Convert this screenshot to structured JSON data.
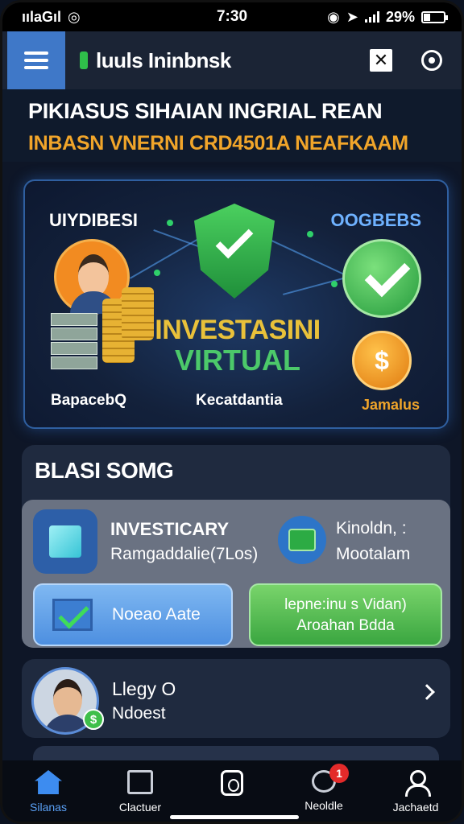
{
  "status_bar": {
    "carrier": "ıılaGıl",
    "time": "7:30",
    "battery": "29%"
  },
  "app_bar": {
    "title": "luuls Ininbnsk"
  },
  "headline": {
    "line1": "PIKIASUS SIHAIAN INGRIAL REAN",
    "line2": "INBASN VNERNI CRD4501A NEAFKAAM"
  },
  "hero": {
    "top_left_label": "UIYDIBESI",
    "top_right_label": "OOGBEBS",
    "brand_line1": "INVESTASINI",
    "brand_line2": "VIRTUAL",
    "coin_symbol": "$",
    "bottom_left_label": "BapacebQ",
    "bottom_center_label": "Kecatdantia",
    "bottom_right_label": "Jamalus"
  },
  "section": {
    "title": "BLASI SOMG",
    "item1_title": "INVESTICARY",
    "item1_subtitle": "Ramgaddalie(7Los)",
    "item2_title": "Kinoldn, :",
    "item2_subtitle": "Mootalam",
    "button_primary": "Noeao Aate",
    "button_secondary_line1": "lepne:inu s Vidan)",
    "button_secondary_line2": "Aroahan Bdda"
  },
  "profile": {
    "name": "Llegy O",
    "subtitle": "Ndoest",
    "badge": "$"
  },
  "bottom_nav": {
    "items": [
      {
        "label": "Silanas",
        "icon": "home-icon"
      },
      {
        "label": "Clactuer",
        "icon": "calendar-icon"
      },
      {
        "label": "",
        "icon": "wallet-icon"
      },
      {
        "label": "Neoldle",
        "icon": "chat-icon"
      },
      {
        "label": "Jachaetd",
        "icon": "user-icon"
      }
    ],
    "notification_count": "1"
  },
  "colors": {
    "accent_blue": "#3f78c8",
    "accent_orange": "#f1a52a",
    "accent_green": "#3aa640",
    "background": "#0e1627"
  }
}
